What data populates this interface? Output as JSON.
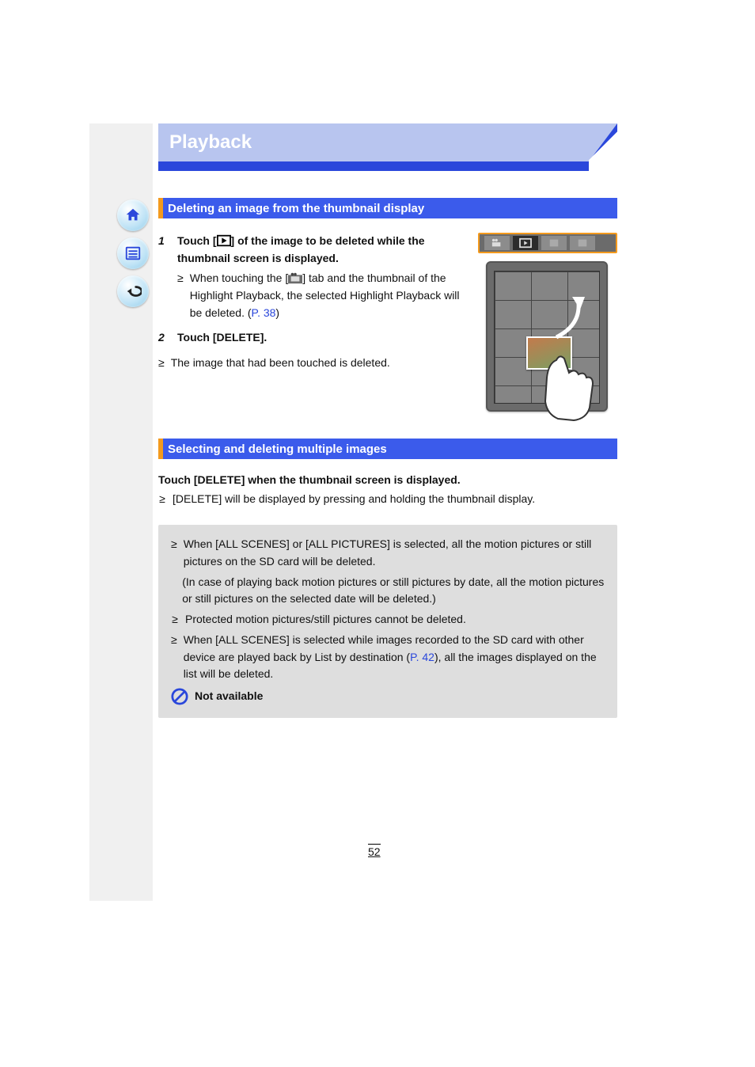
{
  "chapter": {
    "title": "Playback"
  },
  "section1": {
    "title": "Deleting an image from the thumbnail display",
    "step1_num": "1",
    "step1_prefix": "Touch [",
    "step1_mid": "] of the image to be deleted while the thumbnail screen is displayed.",
    "step1_bullet": "≥",
    "step1_bullet_text1": "When touching the [",
    "step1_bullet_text2": "] tab and the thumbnail of the Highlight Playback, the selected Highlight Playback will be deleted. (",
    "step1_link": "P. 38",
    "step1_after": ")",
    "step2_num": "2",
    "step2_text": "Touch [DELETE].",
    "note_bullet": "≥",
    "note_text": "The image that had been touched is deleted."
  },
  "section2": {
    "title": "Selecting and deleting multiple images",
    "intro": "Touch [DELETE] when the thumbnail screen is displayed.",
    "bullet": "≥",
    "bullet_line": "[DELETE] will be displayed by pressing and holding the thumbnail display."
  },
  "note": {
    "bullet1": "When [ALL SCENES] or [ALL PICTURES] is selected, all the motion pictures or still pictures on the SD card will be deleted.",
    "bullet2": "(In case of playing back motion pictures or still pictures by date, all the motion pictures or still pictures on the selected date will be deleted.)",
    "bullet3": "Protected motion pictures/still pictures cannot be deleted.",
    "bullet4_prefix": "When [ALL SCENES] is selected while images recorded to the SD card with other device are played back by List by destination (",
    "bullet4_link": "P. 42",
    "bullet4_suffix": "), all the images displayed on the list will be deleted.",
    "na_title": "Not available"
  },
  "page_number": "52"
}
